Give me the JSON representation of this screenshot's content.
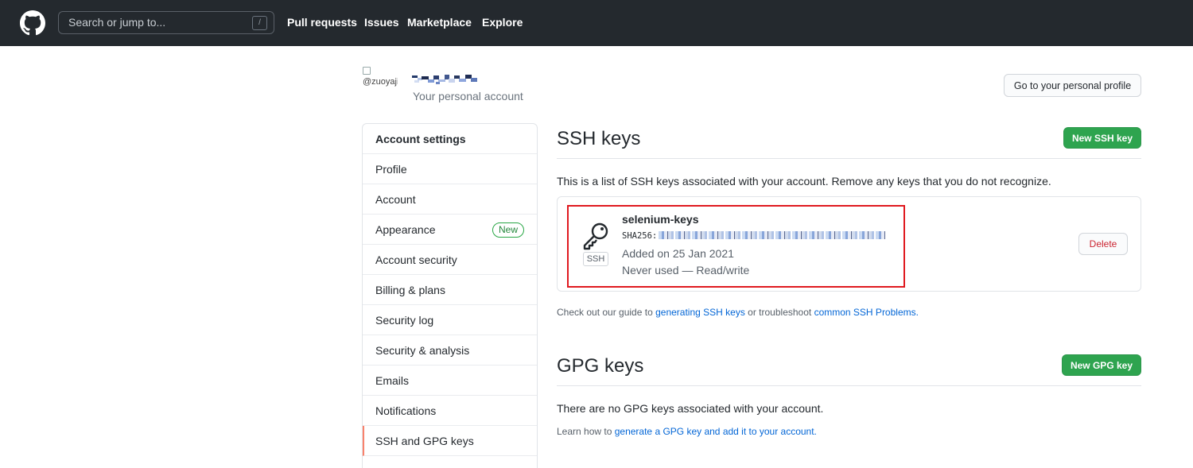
{
  "header": {
    "search_placeholder": "Search or jump to...",
    "search_shortcut": "/",
    "nav": [
      "Pull requests",
      "Issues",
      "Marketplace",
      "Explore"
    ]
  },
  "account": {
    "avatar_alt": "@zuoyajin",
    "subtitle": "Your personal account",
    "profile_button": "Go to your personal profile"
  },
  "sidebar": {
    "heading": "Account settings",
    "items": [
      {
        "label": "Profile"
      },
      {
        "label": "Account"
      },
      {
        "label": "Appearance",
        "badge": "New"
      },
      {
        "label": "Account security"
      },
      {
        "label": "Billing & plans"
      },
      {
        "label": "Security log"
      },
      {
        "label": "Security & analysis"
      },
      {
        "label": "Emails"
      },
      {
        "label": "Notifications"
      },
      {
        "label": "SSH and GPG keys"
      }
    ]
  },
  "ssh": {
    "title": "SSH keys",
    "new_button": "New SSH key",
    "description": "This is a list of SSH keys associated with your account. Remove any keys that you do not recognize.",
    "key": {
      "name": "selenium-keys",
      "fingerprint_prefix": "SHA256:",
      "added": "Added on 25 Jan 2021",
      "usage": "Never used — Read/write",
      "type_label": "SSH",
      "delete_label": "Delete"
    },
    "guide_prefix": "Check out our guide to",
    "guide_link1": "generating SSH keys",
    "guide_middle": "or troubleshoot",
    "guide_link2": "common SSH Problems."
  },
  "gpg": {
    "title": "GPG keys",
    "new_button": "New GPG key",
    "description": "There are no GPG keys associated with your account.",
    "learn_prefix": "Learn how to",
    "learn_link": "generate a GPG key and add it to your account."
  },
  "colors": {
    "header_bg": "#24292e",
    "primary_green": "#2ea44f",
    "link_blue": "#0366d6",
    "danger_red": "#cb2431",
    "highlight_red": "#e0191f",
    "selected_accent": "#f9826c"
  }
}
